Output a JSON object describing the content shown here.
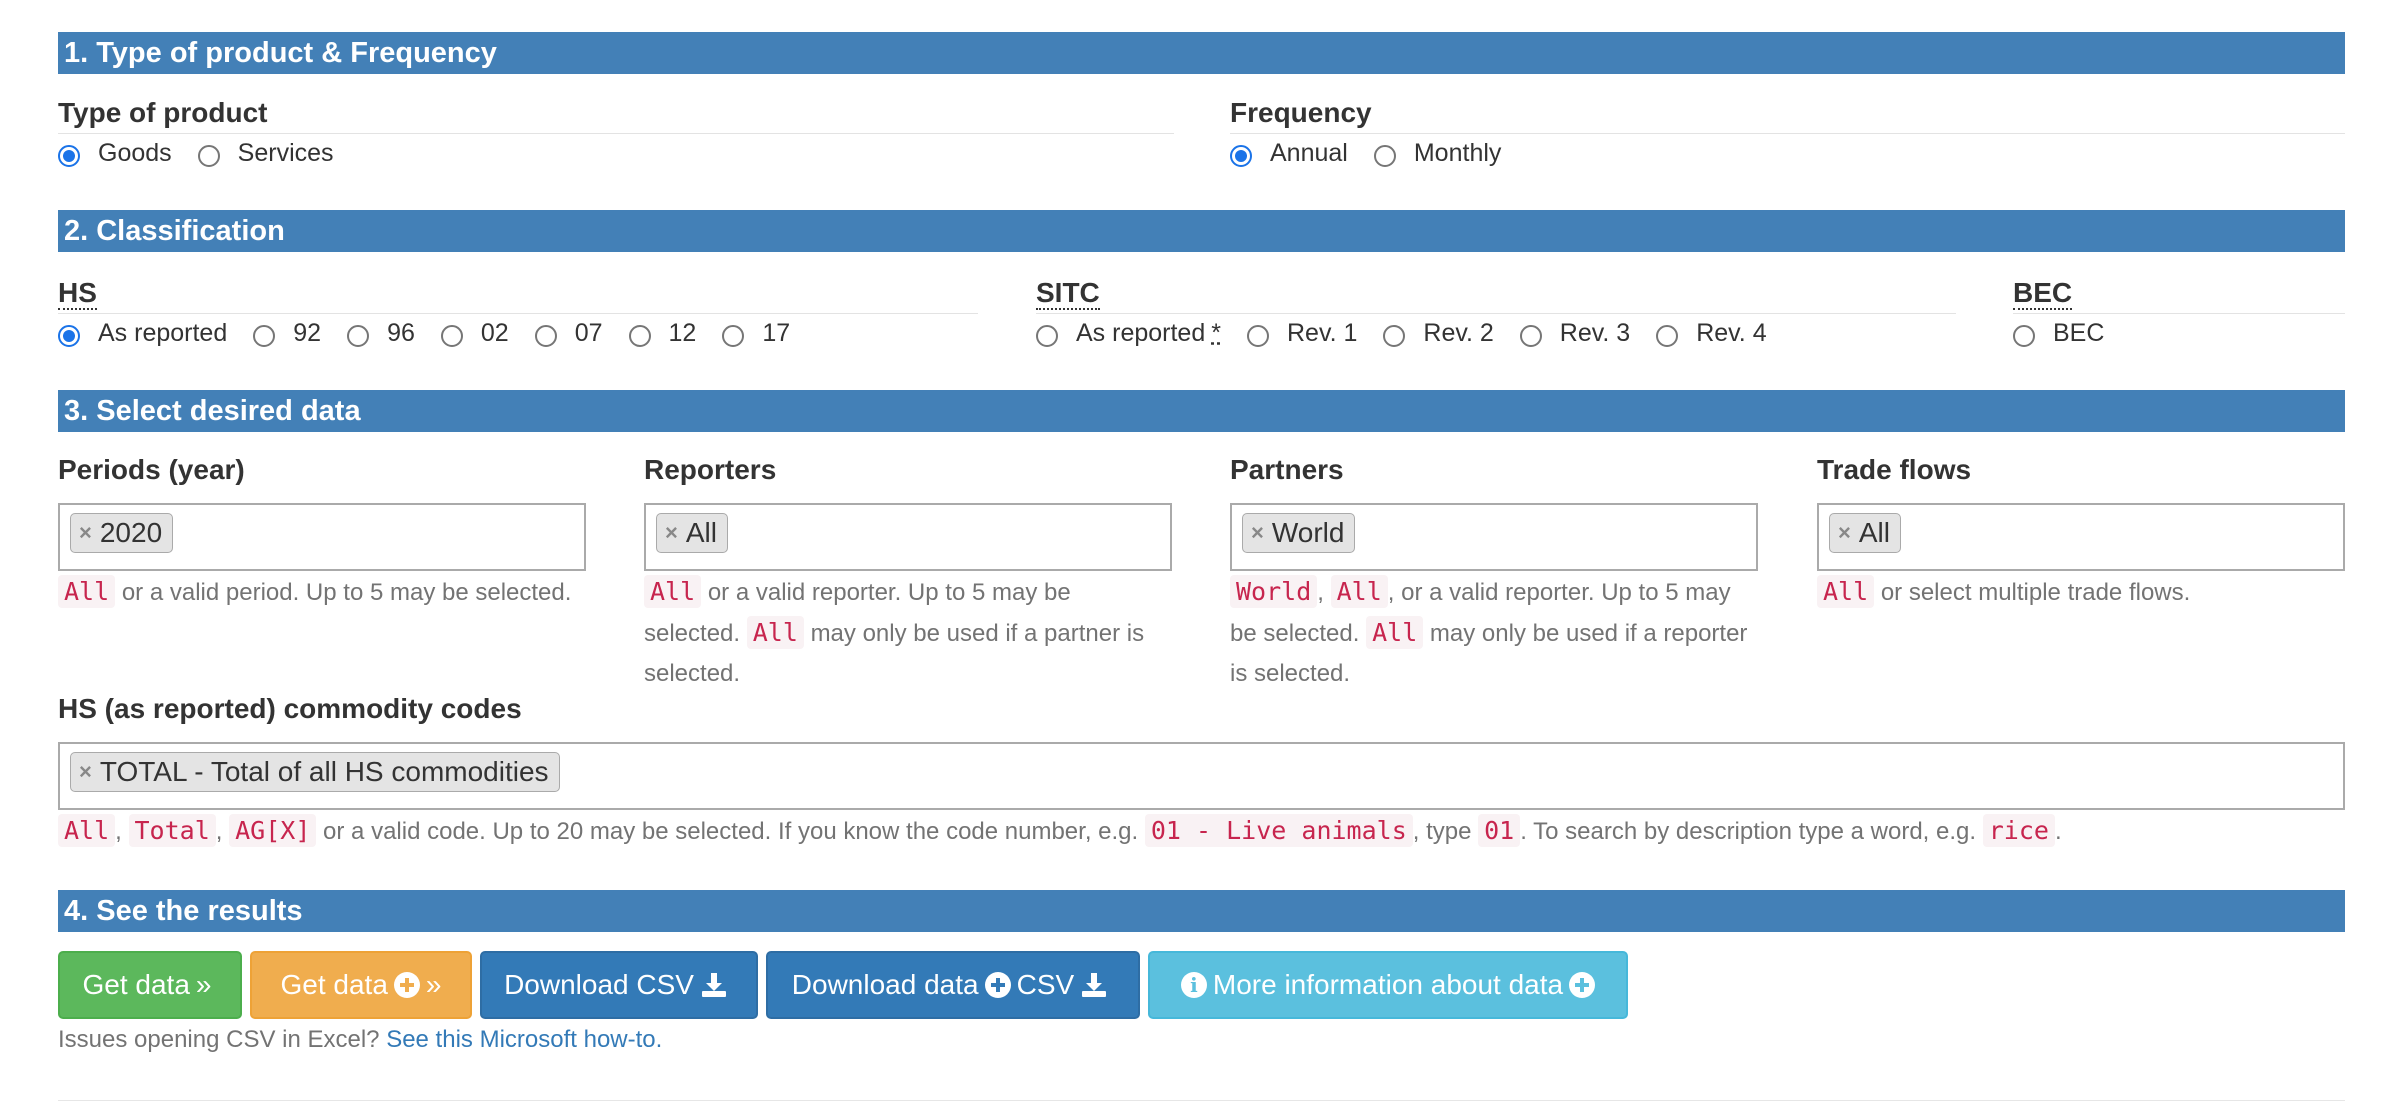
{
  "section1": {
    "title": "1. Type of product & Frequency",
    "type_of_product": {
      "label": "Type of product",
      "options": [
        "Goods",
        "Services"
      ],
      "selected": "Goods"
    },
    "frequency": {
      "label": "Frequency",
      "options": [
        "Annual",
        "Monthly"
      ],
      "selected": "Annual"
    }
  },
  "section2": {
    "title": "2. Classification",
    "hs": {
      "label": "HS",
      "options": [
        "As reported",
        "92",
        "96",
        "02",
        "07",
        "12",
        "17"
      ],
      "selected": "As reported"
    },
    "sitc": {
      "label": "SITC",
      "options": [
        "As reported",
        "Rev. 1",
        "Rev. 2",
        "Rev. 3",
        "Rev. 4"
      ],
      "star": "*",
      "selected": null
    },
    "bec": {
      "label": "BEC",
      "options": [
        "BEC"
      ],
      "selected": null
    }
  },
  "section3": {
    "title": "3. Select desired data",
    "periods": {
      "label": "Periods (year)",
      "tag": "2020",
      "help_code": "All",
      "help_text": "or a valid period. Up to 5 may be selected."
    },
    "reporters": {
      "label": "Reporters",
      "tag": "All",
      "help_code1": "All",
      "help_text1": "or a valid reporter. Up to 5 may be selected.",
      "help_code2": "All",
      "help_text2": "may only be used if a partner is selected."
    },
    "partners": {
      "label": "Partners",
      "tag": "World",
      "help_code1": "World",
      "help_sep": ",",
      "help_code2": "All",
      "help_text1": ", or a valid reporter. Up to 5 may be selected.",
      "help_code3": "All",
      "help_text2": "may only be used if a reporter is selected."
    },
    "trade_flows": {
      "label": "Trade flows",
      "tag": "All",
      "help_code": "All",
      "help_text": "or select multiple trade flows."
    },
    "commodity": {
      "label": "HS (as reported) commodity codes",
      "tag": "TOTAL - Total of all HS commodities",
      "help": {
        "code1": "All",
        "sep1": ",",
        "code2": "Total",
        "sep2": ",",
        "code3": "AG[X]",
        "text1": "or a valid code. Up to 20 may be selected. If you know the code number, e.g.",
        "code4": "01 - Live animals",
        "text2": ", type",
        "code5": "01",
        "text3": ". To search by description type a word, e.g.",
        "code6": "rice",
        "text4": "."
      }
    }
  },
  "section4": {
    "title": "4. See the results",
    "buttons": {
      "get_data": "Get data",
      "get_data_plus": "Get data",
      "download_csv": "Download CSV",
      "download_data_plus_1": "Download data",
      "download_data_plus_2": "CSV",
      "more_info": "More information about data"
    },
    "footer_text": "Issues opening CSV in Excel?",
    "footer_link": "See this Microsoft how-to."
  },
  "icons": {
    "remove": "×",
    "chevrons": "»",
    "download": "download-icon",
    "plus": "plus-circle-icon",
    "info": "info-circle-icon"
  },
  "colors": {
    "section_bar": "#4380b7",
    "green": "#5cb85c",
    "orange": "#f0ad4e",
    "blue": "#337ab7",
    "info": "#5bc0de",
    "code_text": "#c7254e"
  }
}
